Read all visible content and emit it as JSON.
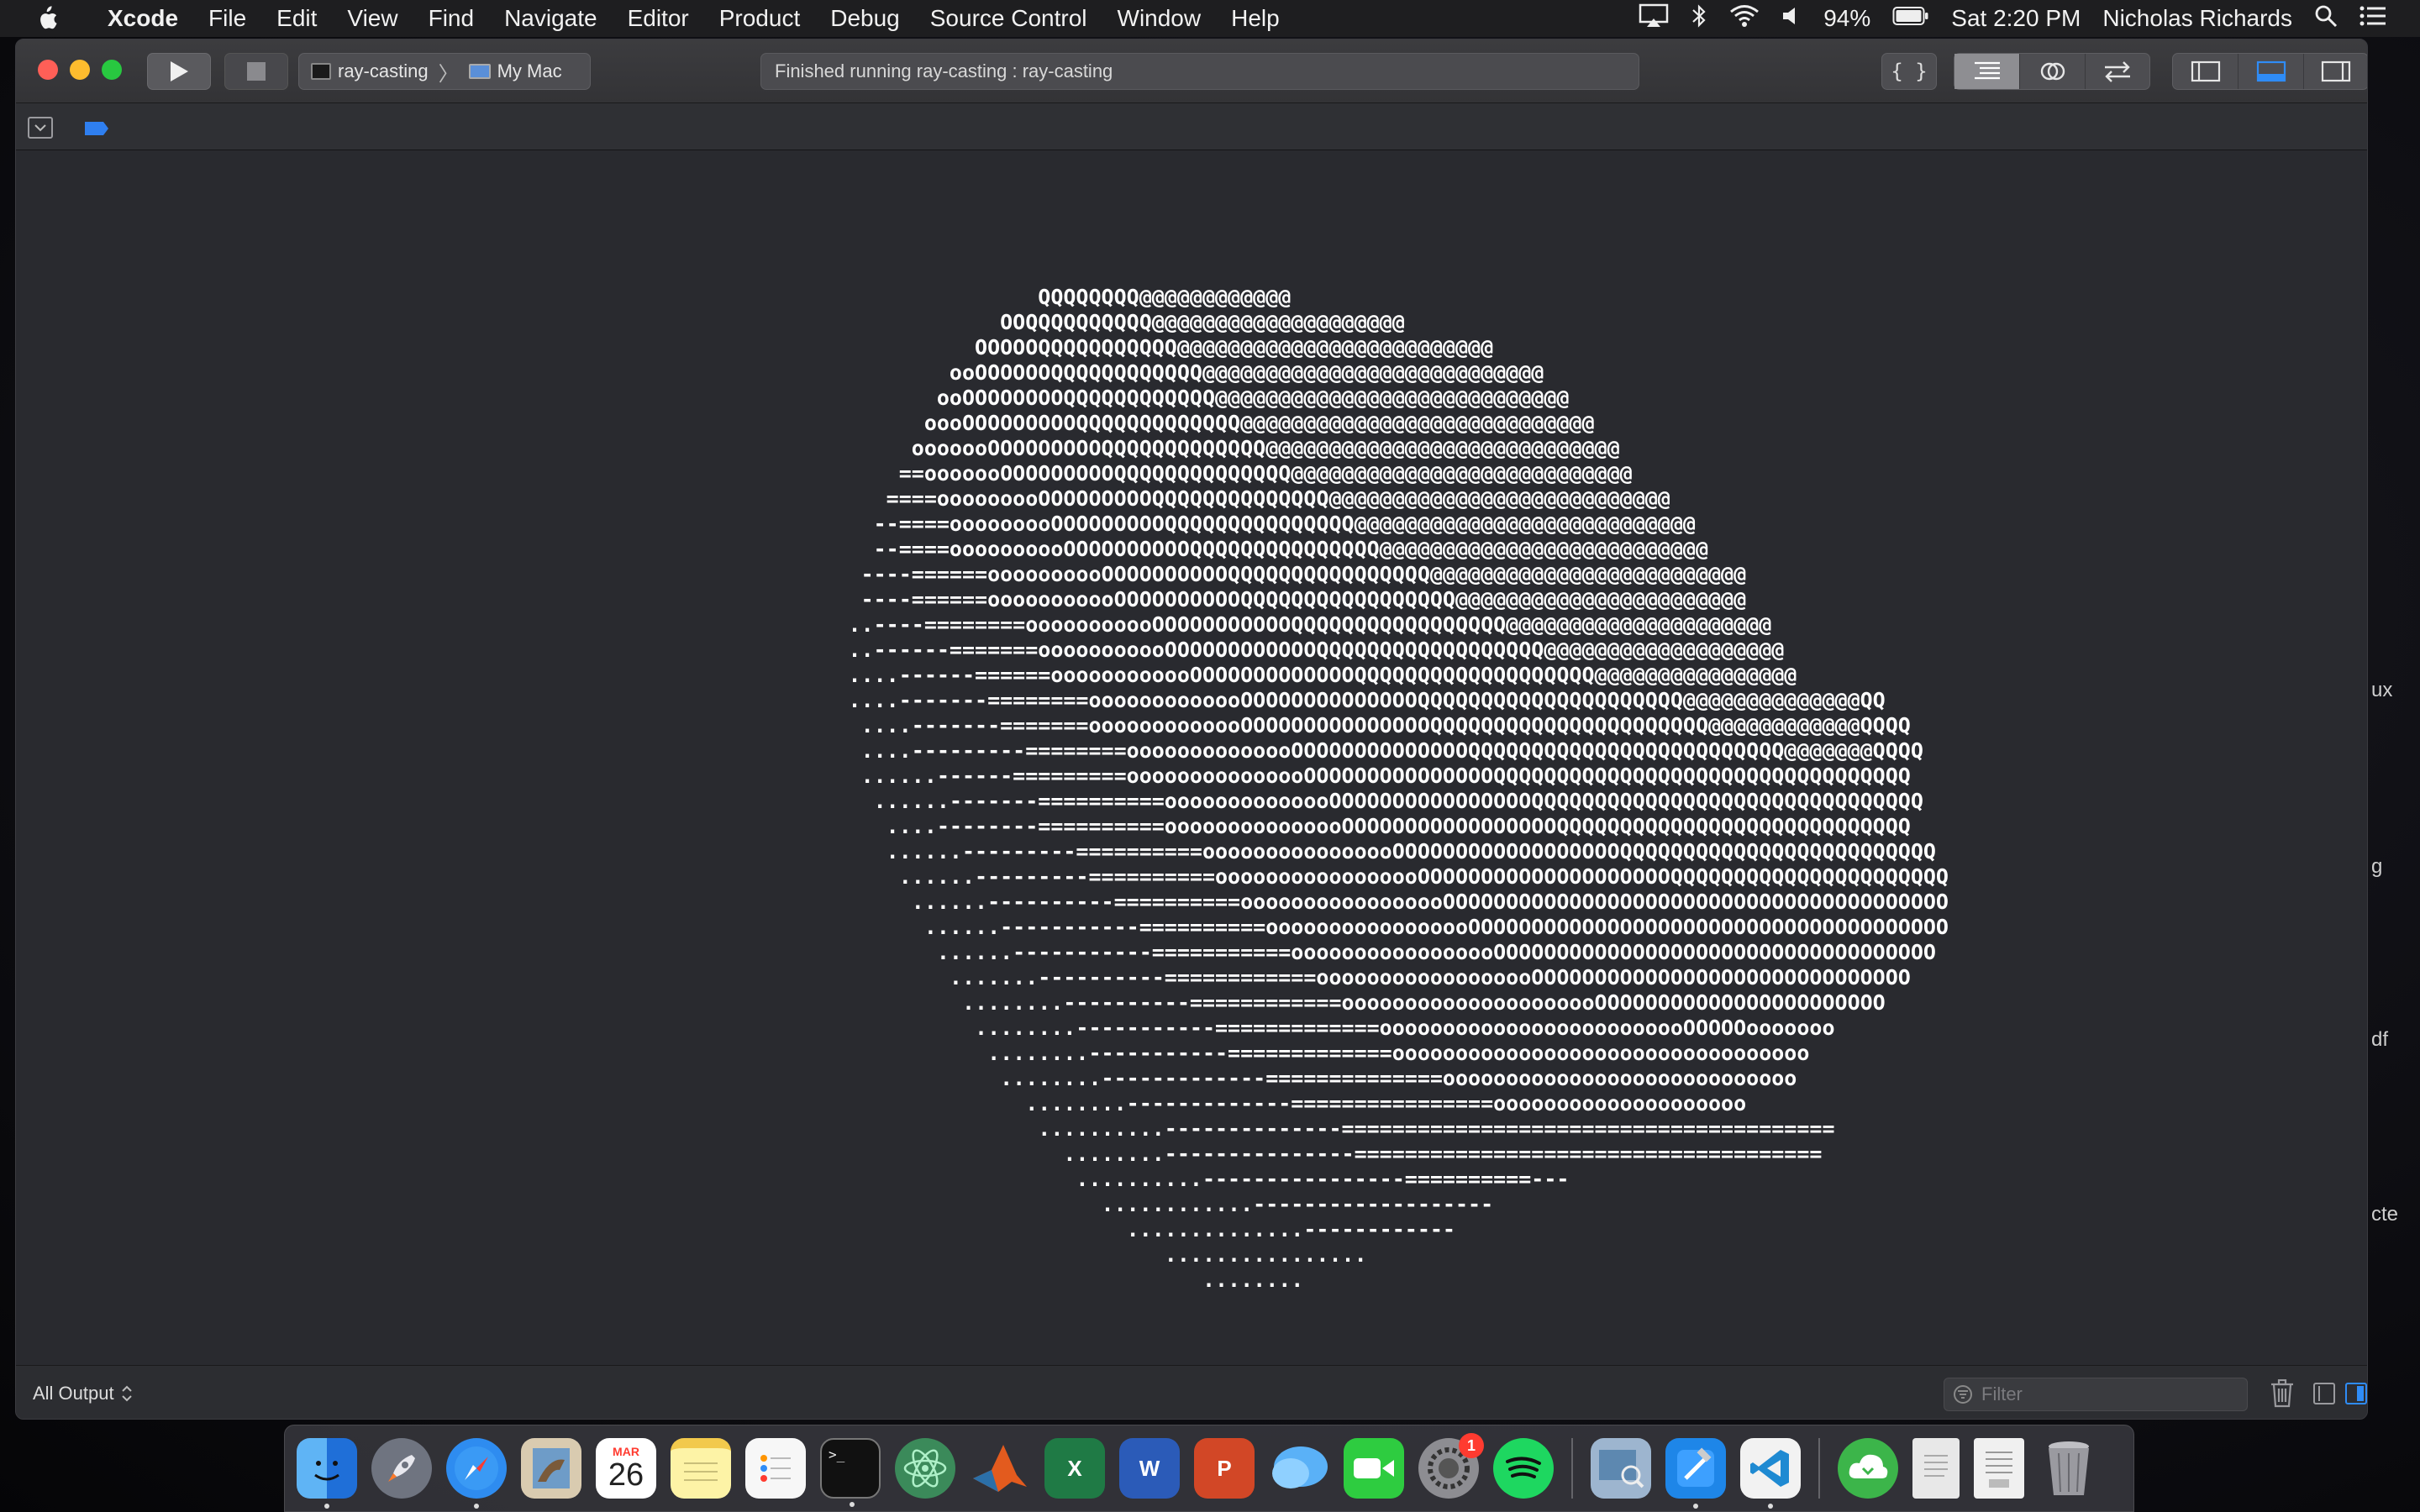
{
  "menubar": {
    "app_name": "Xcode",
    "items": [
      "File",
      "Edit",
      "View",
      "Find",
      "Navigate",
      "Editor",
      "Product",
      "Debug",
      "Source Control",
      "Window",
      "Help"
    ],
    "battery": "94%",
    "clock": "Sat 2:20 PM",
    "user": "Nicholas Richards"
  },
  "toolbar": {
    "scheme": "ray-casting",
    "destination": "My Mac",
    "activity": "Finished running ray-casting : ray-casting",
    "code_button": "{ }"
  },
  "console": {
    "output": "                         QQQQQQQQ@@@@@@@@@@@@\n                      OOQQQQQQQQQQ@@@@@@@@@@@@@@@@@@@@\n                    OOOOOQQQQQQQQQQQ@@@@@@@@@@@@@@@@@@@@@@@@@\n                  ooOOOOOOQQQQQQQQQQQQ@@@@@@@@@@@@@@@@@@@@@@@@@@@\n                 ooOOOOOOOOQQQQQQQQQQQQ@@@@@@@@@@@@@@@@@@@@@@@@@@@@\n                oooOOOOOOOOOQQQQQQQQQQQQQ@@@@@@@@@@@@@@@@@@@@@@@@@@@@\n               ooooooOOOOOOOOOQQQQQQQQQQQQQ@@@@@@@@@@@@@@@@@@@@@@@@@@@@\n              ==ooooooOOOOOOOOOQQQQQQQQQQQQQQ@@@@@@@@@@@@@@@@@@@@@@@@@@@\n             ====ooooooooOOOOOOOOOQQQQQQQQQQQQQQ@@@@@@@@@@@@@@@@@@@@@@@@@@@\n            --====ooooooooOOOOOOOOOQQQQQQQQQQQQQQQ@@@@@@@@@@@@@@@@@@@@@@@@@@@\n            --====oooooooooOOOOOOOOOOQQQQQQQQQQQQQQQ@@@@@@@@@@@@@@@@@@@@@@@@@@\n           ----======oooooooooOOOOOOOOOOQQQQQQQQQQQQQQQQ@@@@@@@@@@@@@@@@@@@@@@@@@\n           ----======ooooooooooOOOOOOOOOOQQQQQQQQQQQQQQQQQ@@@@@@@@@@@@@@@@@@@@@@@\n          ..----========ooooooooooOOOOOOOOOOOQQQQQQQQQQQQQQQQQ@@@@@@@@@@@@@@@@@@@@@\n          ..------=======ooooooooooOOOOOOOOOOOOQQQQQQQQQQQQQQQQQQ@@@@@@@@@@@@@@@@@@@\n          ....------======oooooooooooOOOOOOOOOOOOOQQQQQQQQQQQQQQQQQQQ@@@@@@@@@@@@@@@@\n          ....-------========ooooooooooooOOOOOOOOOOOOOOQQQQQQQQQQQQQQQQQQQQQ@@@@@@@@@@@@@@QQ\n           ....-------=======ooooooooooooOOOOOOOOOOOOOOOQQQQQQQQQQQQQQQQQQQQQQ@@@@@@@@@@@@QQQQ\n           ....---------========oooooooooooooOOOOOOOOOOOOOOQQQQQQQQQQQQQQQQQQQQQQQQQ@@@@@@@QQQQ\n           ......------=========ooooooooooooooOOOOOOOOOOOOOOOQQQQQQQQQQQQQQQQQQQQQQQQQQQQQQQQQ\n            ......-------==========oooooooooooooOOOOOOOOOOOOOOOOQQQQQQQQQQQQQQQQQQQQQQQQQQQQQQQ\n             ....--------==========ooooooooooooooOOOOOOOOOOOOOOOOOQQQQQQQQQQQQQQQQQQQQQQQQQQQQ\n             ......---------==========oooooooooooooooOOOOOOOOOOOOOOOOOOQQQQQQQQQQQQQQQQQQQQQQQQQ\n              ......---------==========ooooooooooooooooOOOOOOOOOOOOOOOOOOOOQQQQQQQQQQQQQQQQQQQQQQ\n               ......----------==========ooooooooooooooooOOOOOOOOOOOOOOOOOOOOOOOOOOOOOOOOOOOOOOOO\n                ......-----------==========ooooooooooooooooOOOOOOOOOOOOOOOOOOOOOOOOOOOOOOOOOOOOOO\n                 ......-----------===========ooooooooooooooooOOOOOOOOOOOOOOOOOOOOOOOOOOOOOOOOOOO\n                  .......----------============oooooooooooooooooOOOOOOOOOOOOOOOOOOOOOOOOOOOOOO\n                   ........----------============ooooooooooooooooooooOOOOOOOOOOOOOOOOOOOOOOO\n                    ........-----------=============ooooooooooooooooooooooooOOOOOooooooo\n                     ........-----------=============ooooooooooooooooooooooooooooooooo\n                      ........-------------==============oooooooooooooooooooooooooooo\n                        ........-------------================oooooooooooooooooooo\n                         ..........--------------=======================================\n                           ........---------------=====================================\n                            ..........----------------==========---\n                              ............-------------------\n                                ..............------------\n                                   ................\n                                      ........"
  },
  "bottom": {
    "output_selector": "All Output",
    "filter_placeholder": "Filter"
  },
  "background_window_fragments": [
    "ux",
    "g",
    "df",
    "cte"
  ],
  "dock": {
    "calendar_month": "MAR",
    "calendar_day": "26",
    "system_prefs_badge": "1",
    "word_letter": "W",
    "powerpoint_letter": "P",
    "excel_letter": "X"
  },
  "colors": {
    "accent": "#2f8cf6",
    "close": "#ff5f57",
    "minimize": "#febc2e",
    "maximize": "#28c840"
  }
}
